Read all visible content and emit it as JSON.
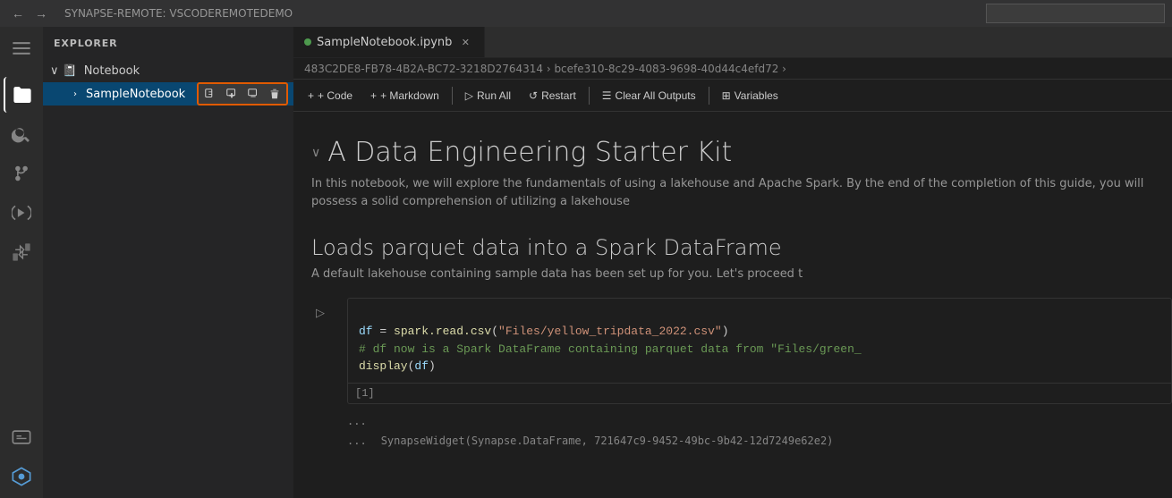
{
  "titlebar": {
    "workspace": "SYNAPSE-REMOTE: VSCODEREMOTEDEMO",
    "back_label": "←",
    "forward_label": "→"
  },
  "sidebar": {
    "title": "Explorer",
    "section_label": "Notebook",
    "parent_chevron": "›",
    "parent_icon": "📓",
    "parent_label": "Notebook",
    "child_chevron": "›",
    "child_label": "SampleNotebook",
    "actions": {
      "icon1": "⬚",
      "icon2": "⊞",
      "icon3": "⊟",
      "icon4": "🗑"
    }
  },
  "tabs": [
    {
      "id": "sample-notebook",
      "label": "SampleNotebook.ipynb",
      "active": true,
      "closeable": true
    }
  ],
  "breadcrumb": {
    "path": "483C2DE8-FB78-4B2A-BC72-3218D2764314 › bcefe310-8c29-4083-9698-40d44c4efd72 ›"
  },
  "toolbar": {
    "add_code_label": "+ Code",
    "add_markdown_label": "+ Markdown",
    "run_all_label": "Run All",
    "restart_label": "Restart",
    "clear_outputs_label": "Clear All Outputs",
    "variables_label": "Variables"
  },
  "notebook": {
    "section1": {
      "toggle": "∨",
      "title": "A Data Engineering Starter Kit",
      "desc": "In this notebook, we will explore the fundamentals of using a lakehouse and Apache Spark. By the end of the completion of this guide, you will possess a solid comprehension of utilizing a lakehouse"
    },
    "section2": {
      "title": "Loads parquet data into a Spark DataFrame",
      "desc": "A default lakehouse containing sample data has been set up for you. Let's proceed t"
    },
    "code_cell": {
      "execution_count": "[1]",
      "line1_var": "df",
      "line1_eq": " = ",
      "line1_func": "spark.read.csv",
      "line1_arg": "\"Files/yellow_tripdata_2022.csv\"",
      "line2_comment": "# df now is a Spark DataFrame containing parquet data from \"Files/green_",
      "line3_func": "display",
      "line3_arg": "df"
    },
    "output_ellipsis1": "...",
    "output_ellipsis2": "...",
    "output_widget": "SynapseWidget(Synapse.DataFrame, 721647c9-9452-49bc-9b42-12d7249e62e2)"
  },
  "activity_bar": {
    "icons": [
      {
        "name": "menu-icon",
        "symbol": "☰"
      },
      {
        "name": "explorer-icon",
        "symbol": "⬚"
      },
      {
        "name": "search-icon",
        "symbol": "🔍"
      },
      {
        "name": "source-control-icon",
        "symbol": "⎇"
      },
      {
        "name": "run-debug-icon",
        "symbol": "▷"
      },
      {
        "name": "extensions-icon",
        "symbol": "⊞"
      },
      {
        "name": "remote-icon",
        "symbol": "⊡"
      },
      {
        "name": "synapse-icon",
        "symbol": "◈"
      }
    ]
  }
}
